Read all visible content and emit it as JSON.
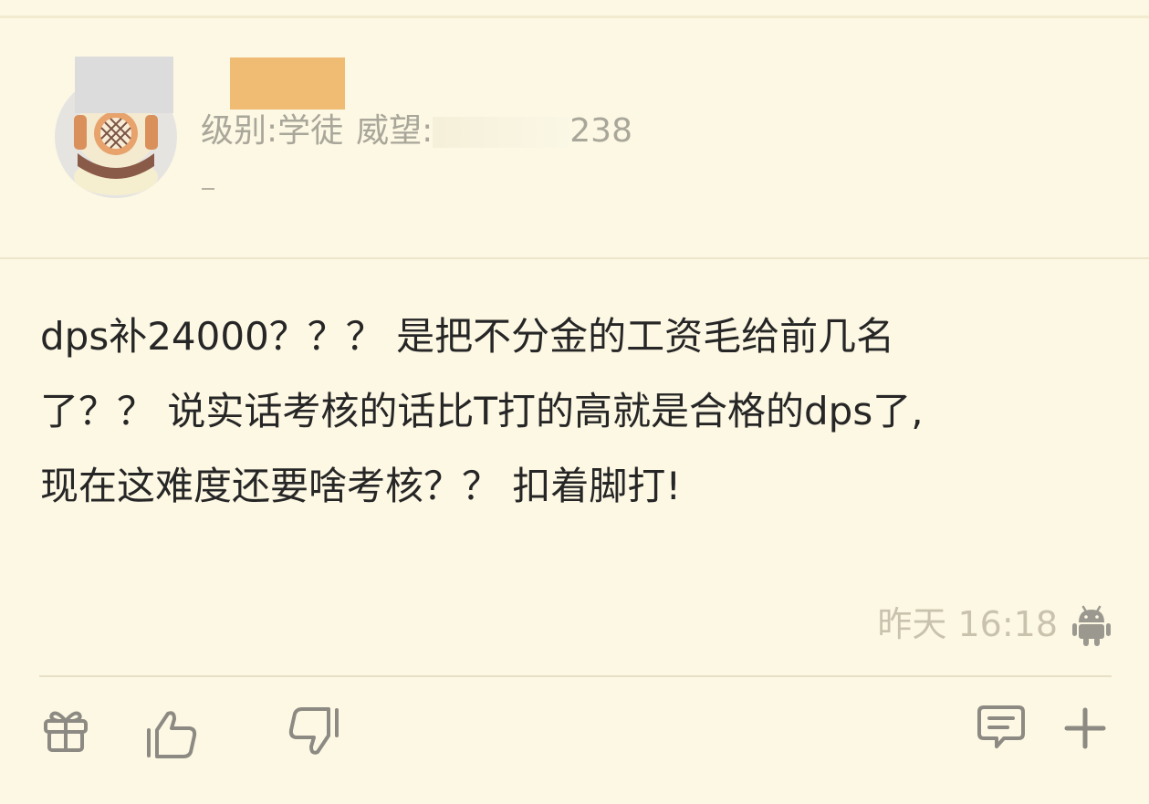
{
  "user": {
    "level_label": "级别:学徒",
    "prestige_label": "威望:",
    "prestige_tail": "238",
    "avatar_icon": "diver-helmet-avatar"
  },
  "post": {
    "lines": [
      "dps补24000？？？ 是把不分金的工资毛给前几名",
      "了？？ 说实话考核的话比T打的高就是合格的dps了,",
      "现在这难度还要啥考核？？ 扣着脚打!"
    ],
    "timestamp": "昨天 16:18",
    "platform_icon": "android-icon"
  },
  "actions": {
    "icons": [
      "gift-icon",
      "thumbs-up-icon",
      "thumbs-down-icon",
      "comment-icon",
      "plus-icon"
    ]
  },
  "colors": {
    "background": "#fdf8e4",
    "text": "#262626",
    "muted": "#a9a69a",
    "icon": "#8c8a82",
    "redact_name": "#f0bb73"
  }
}
